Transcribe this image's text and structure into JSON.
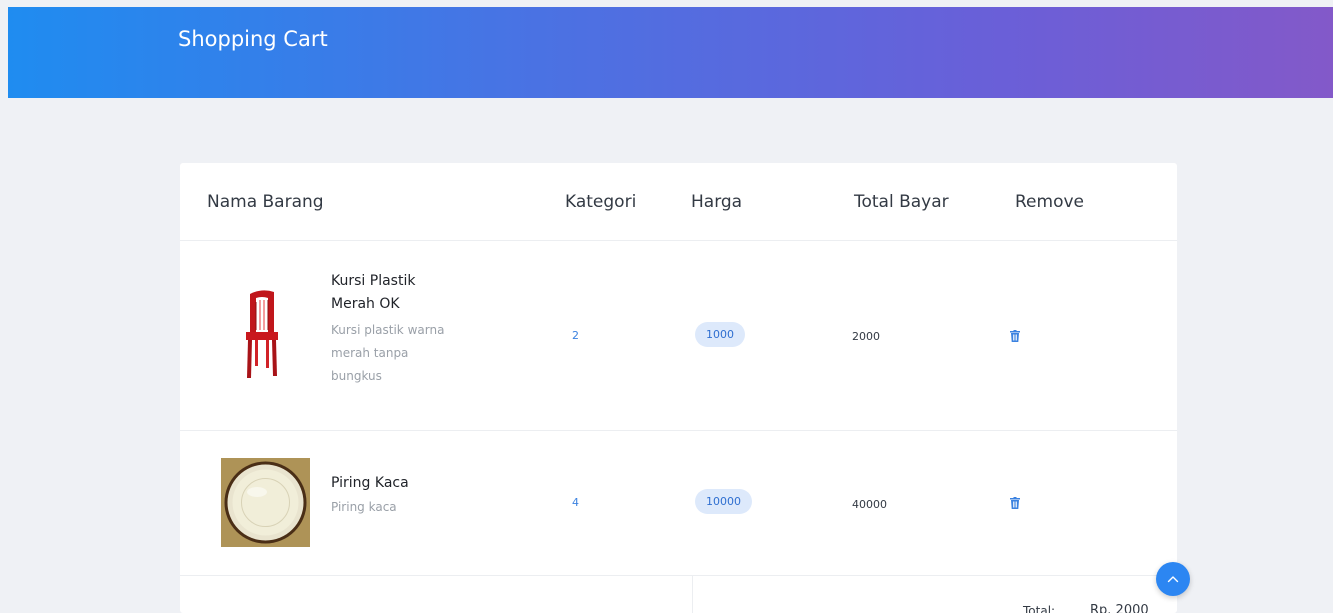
{
  "header": {
    "title": "Shopping Cart"
  },
  "table": {
    "columns": [
      "Nama Barang",
      "Kategori",
      "Harga",
      "Total Bayar",
      "Remove"
    ],
    "rows": [
      {
        "name_lines": [
          "Kursi Plastik",
          "Merah OK"
        ],
        "desc_lines": [
          "Kursi plastik warna",
          "merah tanpa",
          "bungkus"
        ],
        "kategori": "2",
        "harga": "1000",
        "total_bayar": "2000",
        "image_icon": "red-plastic-chair-image",
        "remove_icon": "trash-icon"
      },
      {
        "name_lines": [
          "Piring Kaca"
        ],
        "desc_lines": [
          "Piring kaca"
        ],
        "kategori": "4",
        "harga": "10000",
        "total_bayar": "40000",
        "image_icon": "glass-plate-image",
        "remove_icon": "trash-icon"
      }
    ]
  },
  "summary": {
    "total_label": "Total:",
    "total_value": "Rp. 2000"
  },
  "scroll_top": {
    "icon": "chevron-up-icon"
  },
  "colors": {
    "header_gradient_start": "#1f8cf0",
    "header_gradient_end": "#8359c9",
    "accent": "#2f6fd0",
    "pill_bg": "#dde9fb",
    "scroll_button": "#2c86f2"
  }
}
